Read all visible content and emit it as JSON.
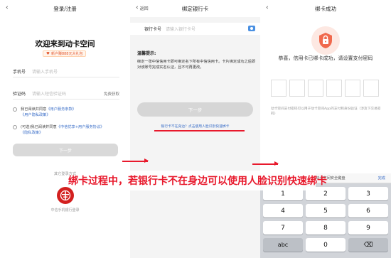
{
  "login": {
    "title": "登录/注册",
    "welcome": "欢迎来到动卡空间",
    "promo": "新户赚888元大礼包",
    "phone_label": "手机号",
    "phone_placeholder": "请输入手机号",
    "code_label": "验证码",
    "code_placeholder": "请输入短信验证码",
    "get_code": "免费获取",
    "agree1_prefix": "我已阅读并同意",
    "agree1_link": "《用户服务条款》",
    "agree1_link2": "《用户隐私政策》",
    "agree2_prefix": "(可选)我已阅读并同意",
    "agree2_link": "《中信优享+用户服务协议》",
    "agree2_link2": "《隐私政策》",
    "next": "下一步",
    "other_login": "其它登录方式",
    "bank_login_caption": "中信手机银行登录"
  },
  "bind": {
    "back": "返回",
    "title": "绑定银行卡",
    "card_label": "银行卡号",
    "card_placeholder": "请输入银行卡号",
    "tip_title": "温馨提示:",
    "tip_text": "绑定一张中信信用卡即可绑定名下所有中信信用卡。卡片绑定成功之后即对该账号完成实名认证，且不可再更改。",
    "next": "下一步",
    "face_link": "银行卡不在身边？点击使用人脸识别快速绑卡"
  },
  "success": {
    "title": "绑卡成功",
    "congrats": "恭喜，信用卡已绑卡成功，请设置支付密码",
    "hint": "动卡空间支付密码可以用于动卡空间App的支付和身份验证（涉及下交易密码）",
    "kb_title": "动卡空间安全键盘",
    "kb_done": "完成",
    "keys": [
      "1",
      "2",
      "3",
      "4",
      "5",
      "6",
      "7",
      "8",
      "9",
      "abc",
      "0",
      "⌫"
    ]
  },
  "annotation": "绑卡过程中，若银行卡不在身边可以使用人脸识别快速绑卡",
  "colors": {
    "accent_red": "#e8192c",
    "link_blue": "#3a6ec8",
    "bank_red": "#d3201f"
  }
}
